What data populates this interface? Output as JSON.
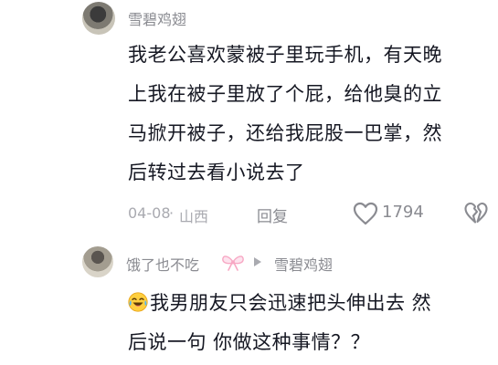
{
  "comment1": {
    "username": "雪碧鸡翅",
    "lines": [
      "我老公喜欢蒙被子里玩手机，有天晚",
      "上我在被子里放了个屁，给他臭的立",
      "马掀开被子，还给我屁股一巴掌，然",
      "后转过去看小说去了"
    ],
    "date": "04-08",
    "separator": "·",
    "location": "山西",
    "reply_label": "回复",
    "like_count": "1794",
    "icons": [
      "heart-outline-icon",
      "broken-heart-icon"
    ]
  },
  "comment2": {
    "username": "饿了也不吃",
    "username_decoration": "pink-bow-icon",
    "reply_to": "雪碧鸡翅",
    "lines": [
      "我男朋友只会迅速把头伸出去 然",
      "后说一句 你做这种事情？？"
    ],
    "leading_emoji": "crying-laughing-emoji-icon"
  },
  "colors": {
    "primary_text": "#161823",
    "secondary_text": "#8a8b91",
    "meta_text": "#a9aab0",
    "bow_pink": "#f7a8c4"
  }
}
